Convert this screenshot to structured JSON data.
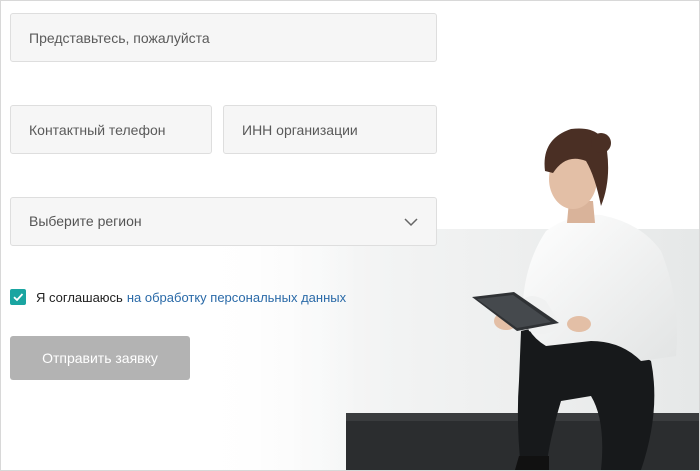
{
  "form": {
    "name_placeholder": "Представьтесь, пожалуйста",
    "phone_placeholder": "Контактный телефон",
    "inn_placeholder": "ИНН организации",
    "region_placeholder": "Выберите регион",
    "consent_checked": true,
    "consent_text": "Я соглашаюсь",
    "consent_link": "на обработку персональных данных",
    "submit_label": "Отправить заявку"
  },
  "colors": {
    "checkbox": "#1aa5a1",
    "link": "#2a6aa8",
    "submit_bg": "#b3b3b3",
    "field_bg": "#f6f6f6"
  },
  "icons": {
    "region_dropdown": "chevron-down-icon",
    "consent_check": "checkmark-icon"
  }
}
